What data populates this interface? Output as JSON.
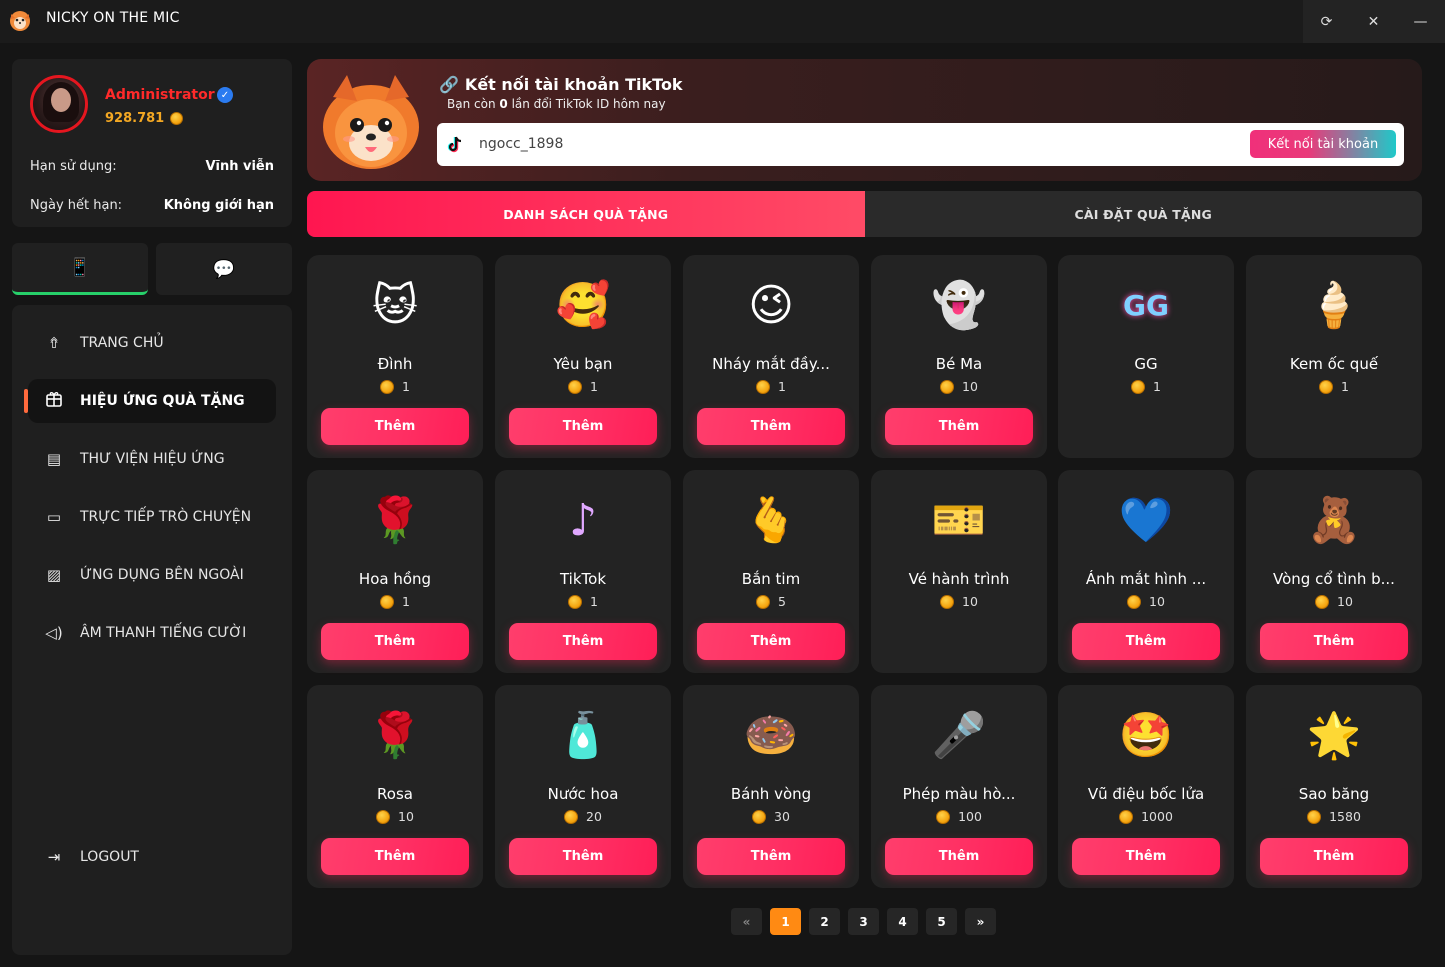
{
  "window": {
    "title": "NICKY ON THE MIC",
    "buttons": [
      "⟳",
      "✕",
      "—"
    ]
  },
  "profile": {
    "name": "Administrator",
    "balance": "928.781",
    "usage_label": "Hạn sử dụng:",
    "usage_value": "Vĩnh viễn",
    "expiry_label": "Ngày hết hạn:",
    "expiry_value": "Không giới hạn"
  },
  "side_tabs": [
    {
      "icon": "phone-icon",
      "glyph": "📱",
      "active": true
    },
    {
      "icon": "chat-icon",
      "glyph": "💬",
      "active": false
    }
  ],
  "nav": [
    {
      "label": "TRANG CHỦ",
      "icon": "home-icon",
      "glyph": "⇮",
      "active": false
    },
    {
      "label": "HIỆU ỨNG QUÀ TẶNG",
      "icon": "gift-icon",
      "glyph": "🎁",
      "active": true
    },
    {
      "label": "THƯ VIỆN HIỆU ỨNG",
      "icon": "library-icon",
      "glyph": "▤",
      "active": false
    },
    {
      "label": "TRỰC TIẾP TRÒ CHUYỆN",
      "icon": "chat-icon",
      "glyph": "▭",
      "active": false
    },
    {
      "label": "ỨNG DỤNG BÊN NGOÀI",
      "icon": "image-icon",
      "glyph": "▨",
      "active": false
    },
    {
      "label": "ÂM THANH TIẾNG CƯỜI",
      "icon": "speaker-icon",
      "glyph": "◁)",
      "active": false
    }
  ],
  "logout": {
    "label": "LOGOUT",
    "glyph": "⇥"
  },
  "banner": {
    "title": "Kết nối tài khoản TikTok",
    "sub_prefix": "Bạn còn",
    "sub_count": "0",
    "sub_suffix": "lần đổi TikTok ID hôm nay",
    "input_value": "ngocc_1898",
    "connect_label": "Kết nối tài khoản"
  },
  "tabs": [
    {
      "label": "DANH SÁCH QUÀ TẶNG",
      "active": true
    },
    {
      "label": "CÀI ĐẶT QUÀ TẶNG",
      "active": false
    }
  ],
  "gifts": [
    {
      "name": "Đình",
      "price": "1",
      "glyph": "🐱",
      "has_button": true
    },
    {
      "name": "Yêu bạn",
      "price": "1",
      "glyph": "🥰",
      "has_button": true
    },
    {
      "name": "Nháy mắt đầy...",
      "price": "1",
      "glyph": "😉",
      "has_button": true
    },
    {
      "name": "Bé Ma",
      "price": "10",
      "glyph": "👻",
      "has_button": true
    },
    {
      "name": "GG",
      "price": "1",
      "glyph": "GG",
      "has_button": false
    },
    {
      "name": "Kem ốc quế",
      "price": "1",
      "glyph": "🍦",
      "has_button": false
    },
    {
      "name": "Hoa hồng",
      "price": "1",
      "glyph": "🌹",
      "has_button": true
    },
    {
      "name": "TikTok",
      "price": "1",
      "glyph": "♪",
      "has_button": true
    },
    {
      "name": "Bắn tim",
      "price": "5",
      "glyph": "🫰",
      "has_button": true
    },
    {
      "name": "Vé hành trình",
      "price": "10",
      "glyph": "🎫",
      "has_button": false
    },
    {
      "name": "Ánh mắt hình ...",
      "price": "10",
      "glyph": "💙",
      "has_button": true
    },
    {
      "name": "Vòng cổ tình b...",
      "price": "10",
      "glyph": "🧸",
      "has_button": true
    },
    {
      "name": "Rosa",
      "price": "10",
      "glyph": "🌹",
      "has_button": true
    },
    {
      "name": "Nước hoa",
      "price": "20",
      "glyph": "🧴",
      "has_button": true
    },
    {
      "name": "Bánh vòng",
      "price": "30",
      "glyph": "🍩",
      "has_button": true
    },
    {
      "name": "Phép màu hò...",
      "price": "100",
      "glyph": "🎤",
      "has_button": true
    },
    {
      "name": "Vũ điệu bốc lửa",
      "price": "1000",
      "glyph": "🤩",
      "has_button": true
    },
    {
      "name": "Sao băng",
      "price": "1580",
      "glyph": "🌟",
      "has_button": true
    }
  ],
  "add_label": "Thêm",
  "pagination": {
    "pages": [
      "«",
      "1",
      "2",
      "3",
      "4",
      "5",
      "»"
    ],
    "current": "1"
  },
  "colors": {
    "accent": "#ff2f63",
    "page_active": "#ff8a13",
    "nav_marker": "#ff6a3d",
    "tab_active_marker": "#27d06a"
  }
}
